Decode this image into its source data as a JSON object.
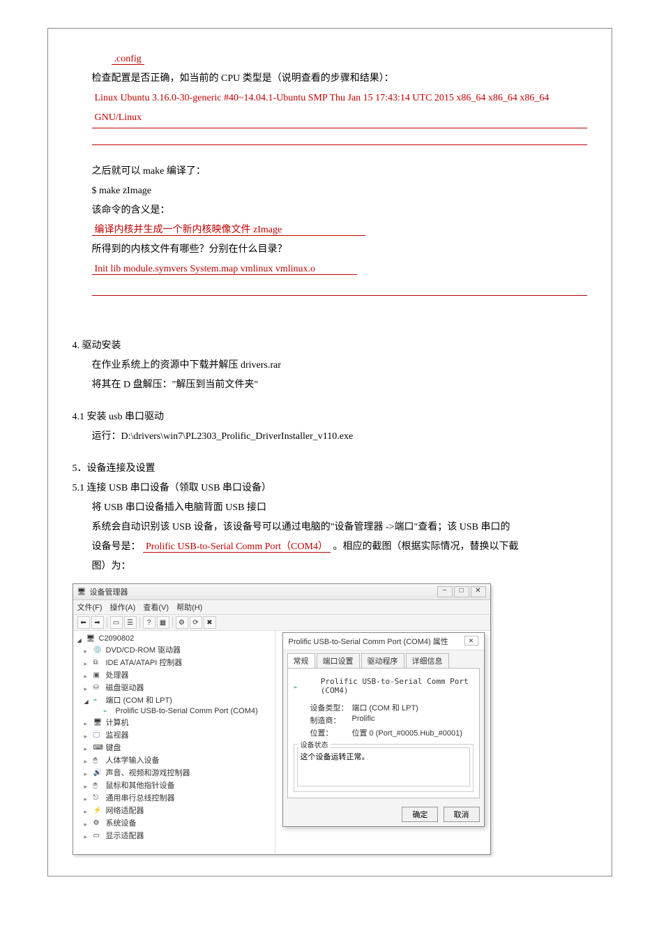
{
  "ans": {
    "config": ".config",
    "uname": "Linux  Ubuntu  3.16.0-30-generic  #40~14.04.1-Ubuntu  SMP  Thu  Jan  15  17:43:14  UTC  2015  x86_64 x86_64  x86_64  GNU/Linux",
    "makeMeaning": "编译内核并生成一个新内核映像文件 zImage",
    "kernelFiles": "Init          lib          module.symvers          System.map          vmlinux          vmlinux.o",
    "usbDeviceName": "Prolific  USB-to-Serial  Comm  Port（COM4）"
  },
  "text": {
    "q_cpu": "检查配置是否正确，如当前的 CPU 类型是（说明查看的步骤和结果）：",
    "afterMake": "之后就可以 make 编译了：",
    "makeCmd": "$ make  zImage",
    "cmdMeaning": "该命令的含义是：",
    "kernelFilesQ": "所得到的内核文件有哪些？分别在什么目录？",
    "sec4": "4.  驱动安装",
    "sec4_l1": "在作业系统上的资源中下载并解压 drivers.rar",
    "sec4_l2": "将其在 D 盘解压：\"解压到当前文件夹\"",
    "sec41": "4.1  安装 usb 串口驱动",
    "sec41_l1": "运行：D:\\drivers\\win7\\PL2303_Prolific_DriverInstaller_v110.exe",
    "sec5": "5．设备连接及设置",
    "sec51": "5.1  连接 USB 串口设备（领取 USB 串口设备）",
    "sec51_l1": "将 USB 串口设备插入电脑背面 USB 接口",
    "sec51_l2a": "系统会自动识别该 USB 设备，该设备号可以通过电脑的\"设备管理器 ->端口\"查看；该 USB 串口的",
    "sec51_l2b_pre": "设备号是：",
    "sec51_l2b_post": " 。相应的截图（根据实际情况，替换以下截",
    "sec51_l3": "图）为："
  },
  "devmgr": {
    "title": "设备管理器",
    "menu": {
      "file": "文件(F)",
      "action": "操作(A)",
      "view": "查看(V)",
      "help": "帮助(H)"
    },
    "root": "C2090802",
    "items": [
      {
        "icon": "disc",
        "label": "DVD/CD-ROM 驱动器"
      },
      {
        "icon": "ide",
        "label": "IDE ATA/ATAPI 控制器"
      },
      {
        "icon": "cpu",
        "label": "处理器"
      },
      {
        "icon": "disk",
        "label": "磁盘驱动器"
      }
    ],
    "portGroup": "端口 (COM 和 LPT)",
    "portChild": "Prolific USB-to-Serial Comm Port (COM4)",
    "items2": [
      {
        "icon": "comp",
        "label": "计算机"
      },
      {
        "icon": "mon",
        "label": "监视器"
      },
      {
        "icon": "kb",
        "label": "键盘"
      },
      {
        "icon": "hid",
        "label": "人体学输入设备"
      },
      {
        "icon": "snd",
        "label": "声音、视频和游戏控制器"
      },
      {
        "icon": "mouse",
        "label": "鼠标和其他指针设备"
      },
      {
        "icon": "usb",
        "label": "通用串行总线控制器"
      },
      {
        "icon": "net",
        "label": "网络适配器"
      },
      {
        "icon": "sys",
        "label": "系统设备"
      },
      {
        "icon": "disp",
        "label": "显示适配器"
      }
    ]
  },
  "prop": {
    "title": "Prolific USB-to-Serial Comm Port (COM4) 属性",
    "tabs": {
      "general": "常规",
      "port": "端口设置",
      "driver": "驱动程序",
      "detail": "详细信息"
    },
    "devName": "Prolific USB-to-Serial Comm Port (COM4)",
    "labels": {
      "type": "设备类型：",
      "mfg": "制造商：",
      "loc": "位置：",
      "statusLegend": "设备状态"
    },
    "values": {
      "type": "端口 (COM 和 LPT)",
      "mfg": "Prolific",
      "loc": "位置 0 (Port_#0005.Hub_#0001)"
    },
    "status": "这个设备运转正常。",
    "btns": {
      "ok": "确定",
      "cancel": "取消"
    }
  }
}
